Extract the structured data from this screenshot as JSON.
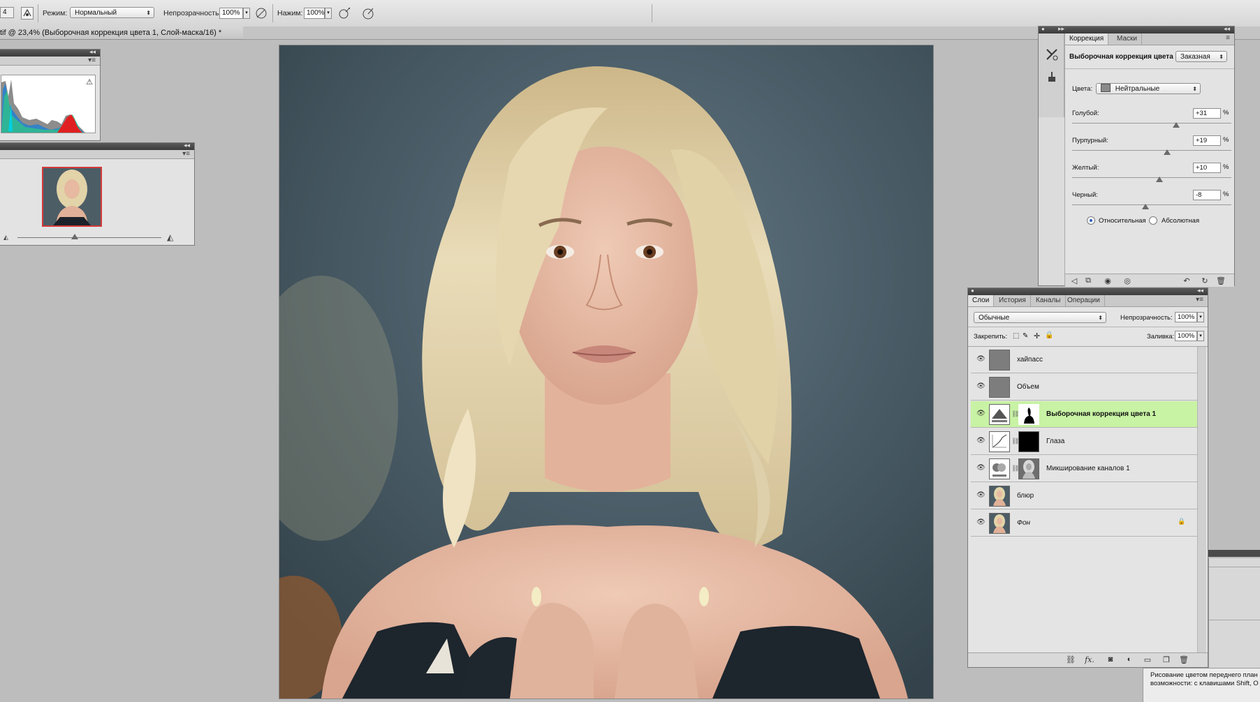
{
  "optionsBar": {
    "mode_label": "Режим:",
    "mode_value": "Нормальный",
    "opacity_label": "Непрозрачность:",
    "opacity_value": "100%",
    "flow_label": "Нажим:",
    "flow_value": "100%",
    "brush_size": "4"
  },
  "document": {
    "tab_title": "tif @ 23,4% (Выборочная коррекция цвета 1, Слой-маска/16) *"
  },
  "correctionPanel": {
    "tabs": [
      "Коррекция",
      "Маски"
    ],
    "title": "Выборочная коррекция цвета",
    "preset": "Заказная",
    "colors_label": "Цвета:",
    "colors_value": "Нейтральные",
    "sliders": [
      {
        "label": "Голубой:",
        "value": "+31",
        "pct": "%",
        "level": 31
      },
      {
        "label": "Пурпурный:",
        "value": "+19",
        "pct": "%",
        "level": 19
      },
      {
        "label": "Желтый:",
        "value": "+10",
        "pct": "%",
        "level": 10
      },
      {
        "label": "Черный:",
        "value": "-8",
        "pct": "%",
        "level": -8
      }
    ],
    "method_relative": "Относительная",
    "method_absolute": "Абсолютная",
    "method_selected": "Относительная"
  },
  "layersPanel": {
    "tabs": [
      "Слои",
      "История",
      "Каналы",
      "Операции"
    ],
    "blend_mode": "Обычные",
    "opacity_label": "Непрозрачность:",
    "opacity_value": "100%",
    "lock_label": "Закрепить:",
    "fill_label": "Заливка:",
    "fill_value": "100%",
    "layers": [
      {
        "name": "хайпасс",
        "selected": false
      },
      {
        "name": "Объем",
        "selected": false
      },
      {
        "name": "Выборочная коррекция цвета 1",
        "selected": true
      },
      {
        "name": "Глаза",
        "selected": false
      },
      {
        "name": "Микширование каналов 1",
        "selected": false
      },
      {
        "name": "блюр",
        "selected": false
      },
      {
        "name": "Фон",
        "selected": false,
        "locked": true
      }
    ]
  },
  "infoPanel": {
    "line1": "Рисование цветом переднего план",
    "line2": "возможности: с клавишами Shift, О"
  },
  "colors": {
    "selected_layer": "#c8f2a4",
    "panel_bg": "#e3e3e3",
    "workspace": "#bdbdbd"
  }
}
